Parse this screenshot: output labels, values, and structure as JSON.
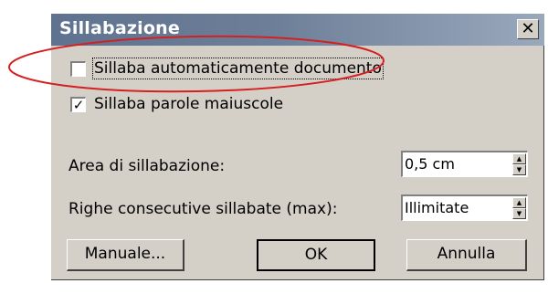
{
  "dialog": {
    "title": "Sillabazione",
    "close_glyph": "✕"
  },
  "options": {
    "auto_hyphenate": {
      "label": "Sillaba automaticamente documento",
      "checked": false
    },
    "hyphenate_caps": {
      "label": "Sillaba parole maiuscole",
      "checked": true,
      "check_glyph": "✓"
    }
  },
  "fields": {
    "hyphenation_zone": {
      "label": "Area di sillabazione:",
      "value": "0,5 cm"
    },
    "consecutive_hyphens": {
      "label": "Righe consecutive sillabate (max):",
      "value": "Illimitate"
    }
  },
  "buttons": {
    "manual": "Manuale...",
    "ok": "OK",
    "cancel": "Annulla"
  },
  "annotation": {
    "color": "#d42020"
  }
}
